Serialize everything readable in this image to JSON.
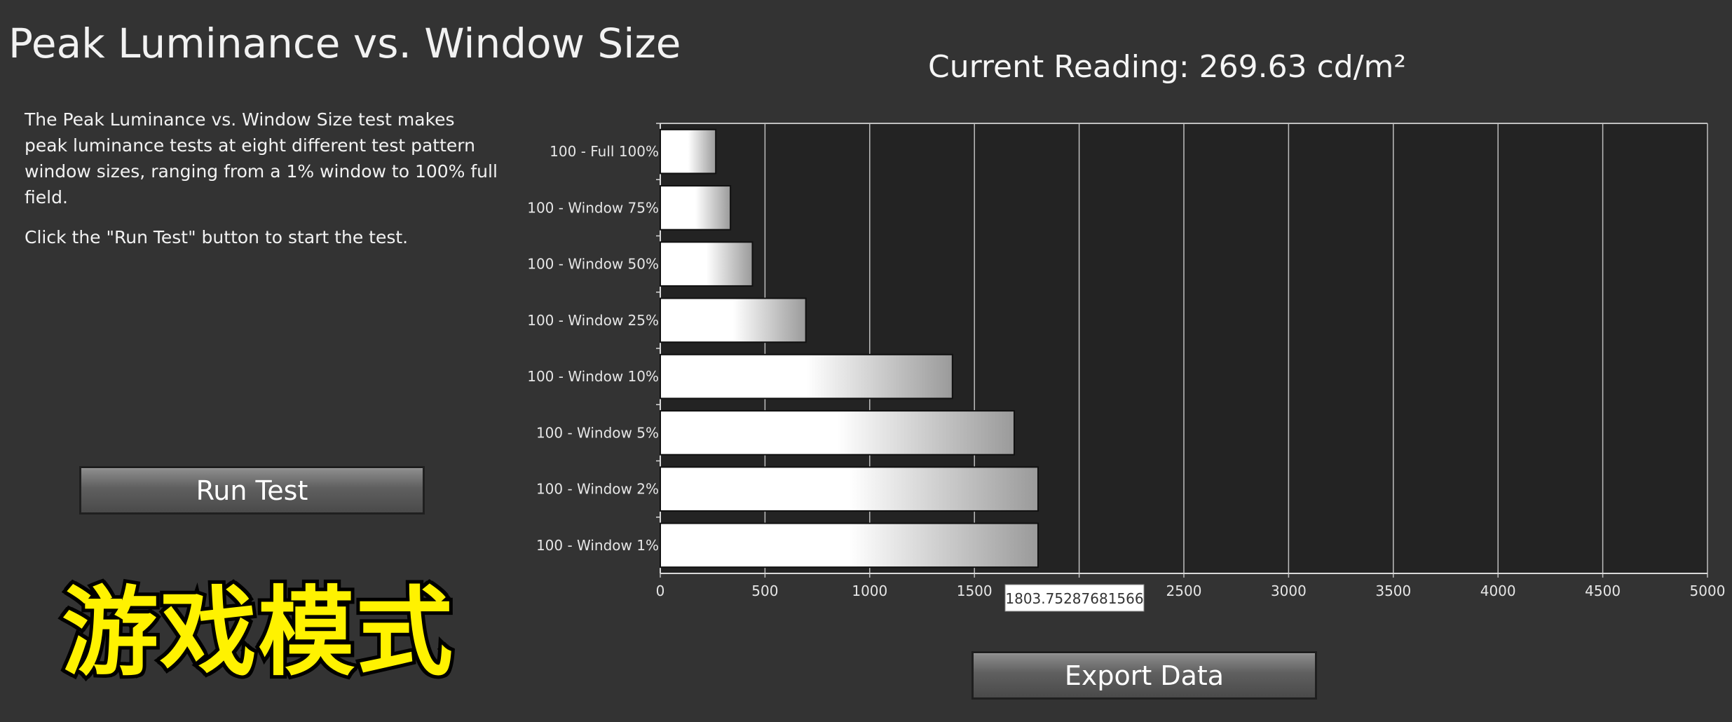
{
  "page": {
    "title": "Peak Luminance vs. Window Size",
    "description": [
      "The Peak Luminance vs. Window Size test makes peak luminance tests at eight different test pattern window sizes, ranging from a 1% window to 100% full field.",
      "Click the \"Run Test\" button to start the test."
    ],
    "reading": "Current Reading: 269.63 cd/m²",
    "run_button": "Run Test",
    "export_button": "Export  Data",
    "watermark": "游戏模式"
  },
  "colors": {
    "background": "#333333",
    "plot_background": "#232323",
    "grid": "#bfbfbf",
    "watermark": "#fff200"
  },
  "chart_data": {
    "type": "bar",
    "orientation": "horizontal",
    "categories": [
      "100 - Full  100%",
      "100 - Window 75%",
      "100 - Window 50%",
      "100 - Window 25%",
      "100 - Window 10%",
      "100 - Window  5%",
      "100 - Window  2%",
      "100 - Window  1%"
    ],
    "values": [
      265,
      335,
      440,
      695,
      1395,
      1690,
      1803.75287681566,
      1803.75287681566
    ],
    "xlim": [
      0,
      5000
    ],
    "xticks": [
      0,
      500,
      1000,
      1500,
      2000,
      2500,
      3000,
      3500,
      4000,
      4500,
      5000
    ],
    "grid": true,
    "tooltip": "1803.75287681566",
    "title": "",
    "xlabel": "",
    "ylabel": ""
  }
}
